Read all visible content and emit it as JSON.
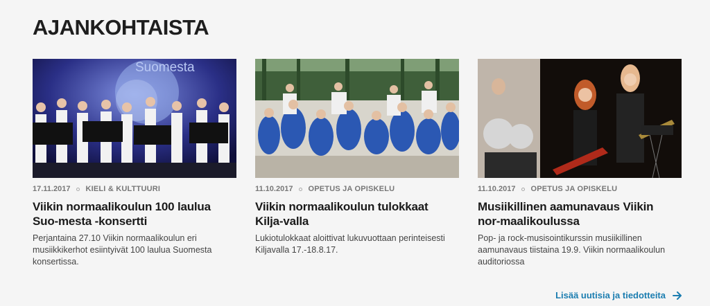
{
  "section": {
    "title": "AJANKOHTAISTA"
  },
  "articles": [
    {
      "date": "17.11.2017",
      "category": "KIELI & KULTTUURI",
      "title": "Viikin normaalikoulun 100 laulua Suo-mesta -konsertti",
      "excerpt": "Perjantaina 27.10 Viikin normaalikoulun eri musiikkikerhot esiintyivät 100 laulua Suomesta konsertissa.",
      "image_text": "Suomesta"
    },
    {
      "date": "11.10.2017",
      "category": "OPETUS JA OPISKELU",
      "title": "Viikin normaalikoulun tulokkaat Kilja-valla",
      "excerpt": "Lukiotulokkaat aloittivat lukuvuottaan perinteisesti Kiljavalla 17.-18.8.17."
    },
    {
      "date": "11.10.2017",
      "category": "OPETUS JA OPISKELU",
      "title": "Musiikillinen aamunavaus Viikin nor-maalikoulussa",
      "excerpt": "Pop- ja rock-musisointikurssin musiikillinen aamunavaus tiistaina 19.9. Viikin normaalikoulun auditoriossa"
    }
  ],
  "more_link": {
    "label": "Lisää uutisia ja tiedotteita",
    "icon": "arrow-right-icon",
    "color": "#1b7db0"
  }
}
